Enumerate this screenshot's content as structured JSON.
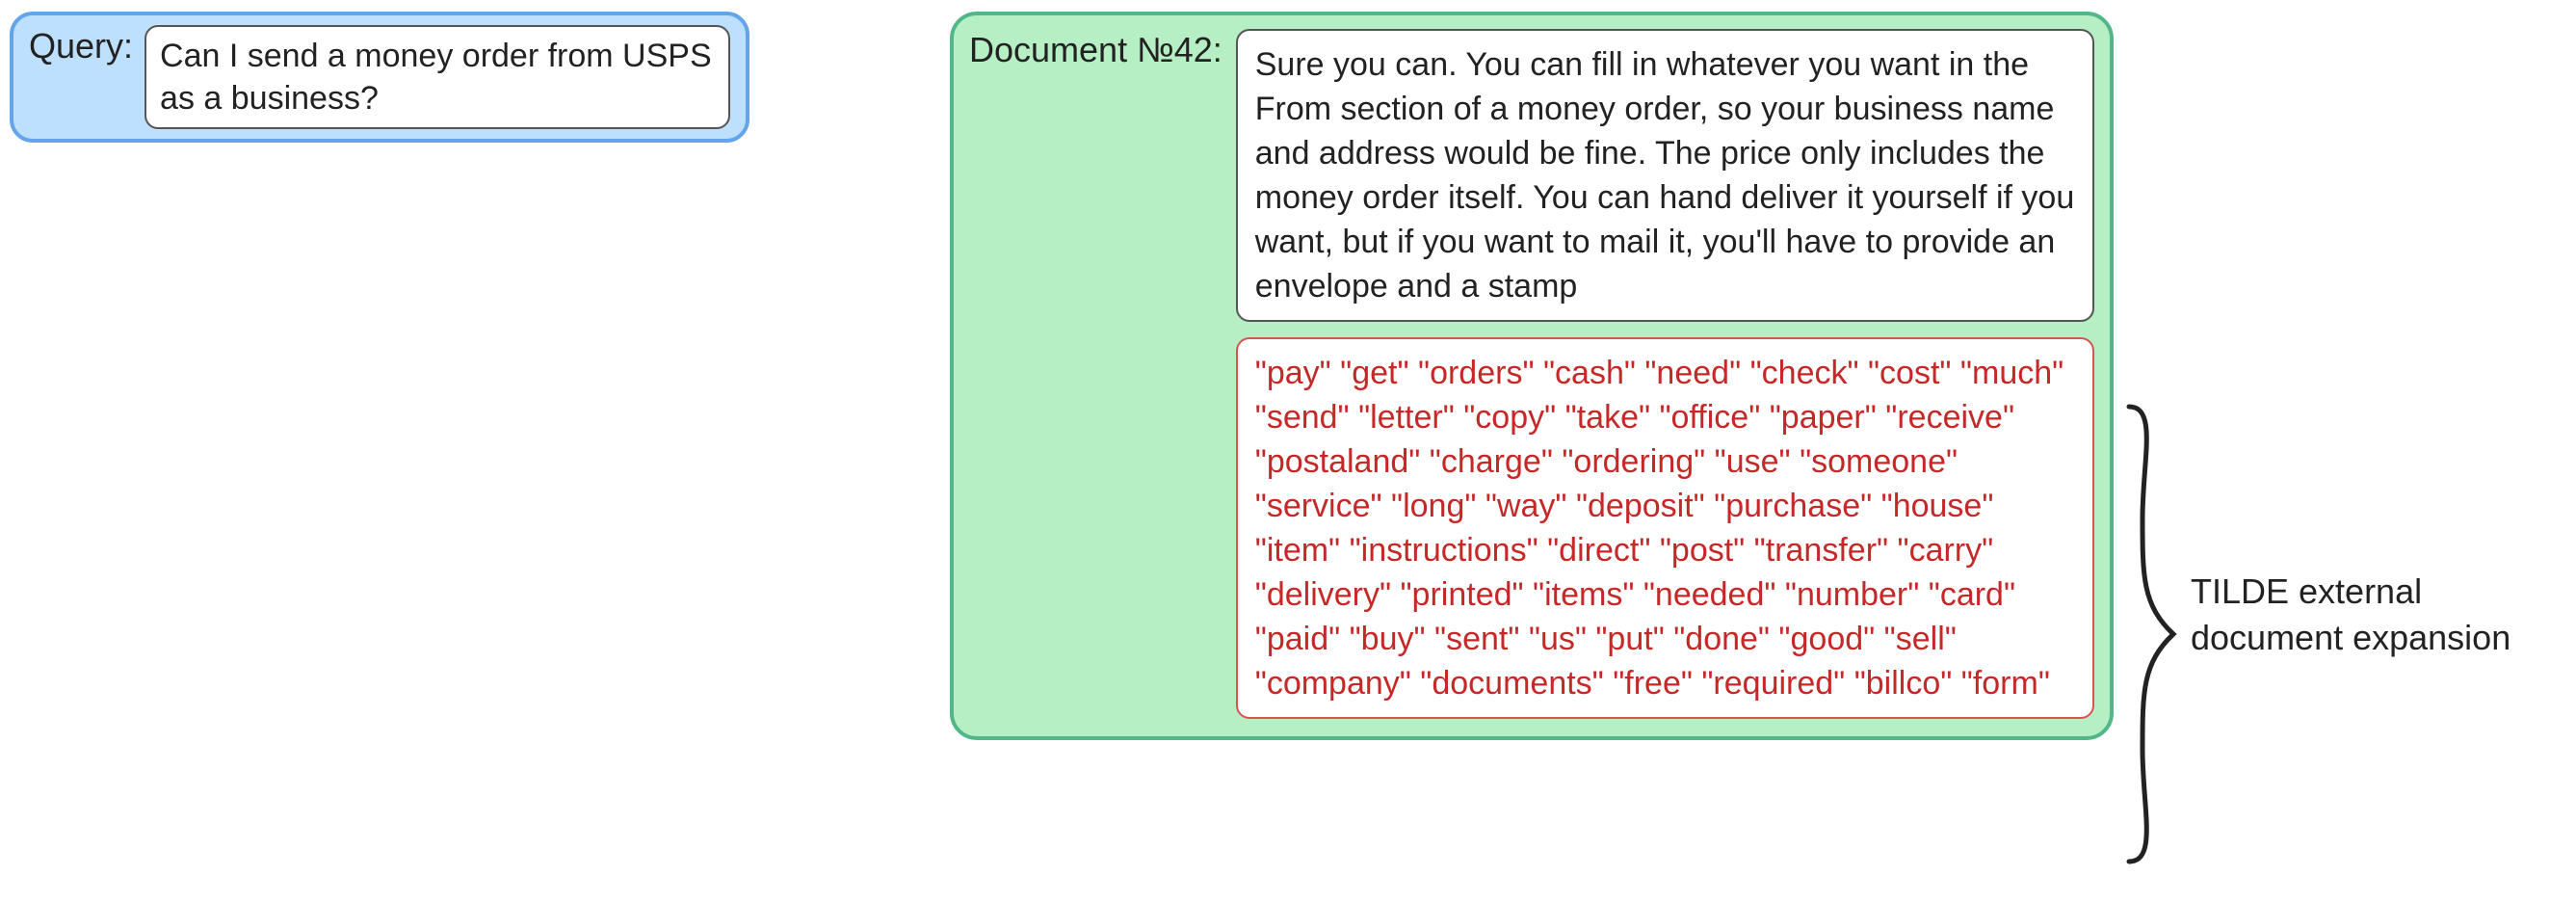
{
  "query": {
    "label": "Query:",
    "text": "Can I send a money order from USPS as a business?"
  },
  "document": {
    "label": "Document №42:",
    "text": "Sure you can. You can fill in whatever you want in the From section of a money order, so your business name and address would be fine. The price only includes the money order itself. You can hand deliver it yourself if you want, but if you want to mail it, you'll have to provide an envelope and a stamp",
    "expansion_terms": [
      "pay",
      "get",
      "orders",
      "cash",
      "need",
      "check",
      "cost",
      "much",
      "send",
      "letter",
      "copy",
      "take",
      "office",
      "paper",
      "receive",
      "postaland",
      "charge",
      "ordering",
      "use",
      "someone",
      "service",
      "long",
      "way",
      "deposit",
      "purchase",
      "house",
      "item",
      "instructions",
      "direct",
      "post",
      "transfer",
      "carry",
      "delivery",
      "printed",
      "items",
      "needed",
      "number",
      "card",
      "paid",
      "buy",
      "sent",
      "us",
      "put",
      "done",
      "good",
      "sell",
      "company",
      "documents",
      "free",
      "required",
      "billco",
      "form"
    ]
  },
  "annotation": "TILDE external document expansion"
}
